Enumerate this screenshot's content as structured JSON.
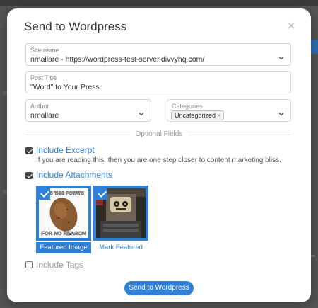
{
  "modal": {
    "title": "Send to Wordpress",
    "close_label": "×"
  },
  "site": {
    "label": "Site name",
    "value": "nmallare - https://wordpress-test-server.divvyhq.com/"
  },
  "post_title": {
    "label": "Post Title",
    "value": "\"Word\" to Your Press"
  },
  "author": {
    "label": "Author",
    "value": "nmallare"
  },
  "categories": {
    "label": "Categories",
    "chips": [
      "Uncategorized"
    ],
    "chip_remove": "×"
  },
  "optional": {
    "label": "Optional Fields"
  },
  "excerpt": {
    "label": "Include Excerpt",
    "checked": true,
    "description": "If you are reading this, then you are one step closer to content marketing bliss."
  },
  "attachments": {
    "label": "Include Attachments",
    "checked": true,
    "items": [
      {
        "caption": "Featured Image",
        "selected": true,
        "top_text": "AND THIS POTATO",
        "bottom_text": "FOR NO REASON"
      },
      {
        "caption": "Mark Featured",
        "selected": true
      }
    ]
  },
  "tags": {
    "label": "Include Tags",
    "checked": false
  },
  "send_button": {
    "label": "Send to Wordpress"
  },
  "colors": {
    "accent": "#2f80d6",
    "overlay": "#555555"
  },
  "icons": {
    "close": "close-icon",
    "dropdown": "chevron-down-icon",
    "check": "checkmark-icon"
  }
}
